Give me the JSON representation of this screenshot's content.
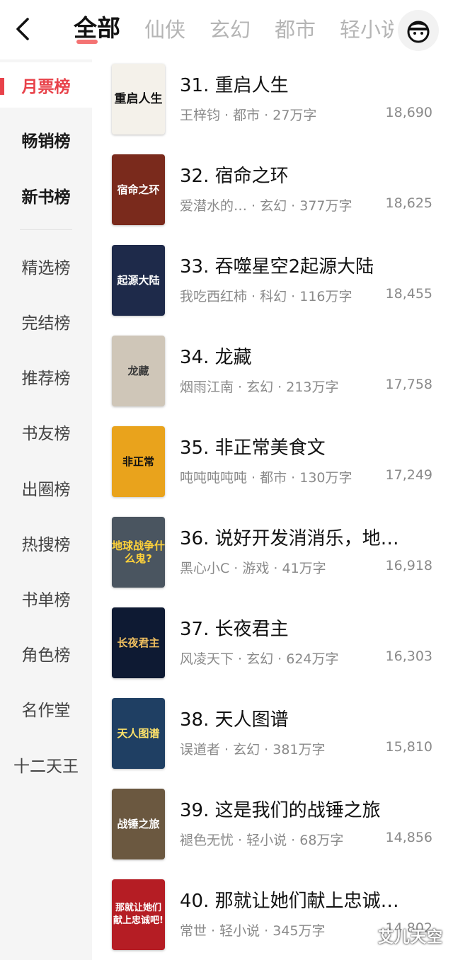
{
  "header": {
    "back_icon": "chevron-left-icon",
    "tabs": [
      {
        "label": "全部",
        "active": true
      },
      {
        "label": "仙侠"
      },
      {
        "label": "玄幻"
      },
      {
        "label": "都市"
      },
      {
        "label": "轻小说"
      }
    ],
    "avatar_icon": "user-avatar-icon"
  },
  "sidebar": {
    "items": [
      {
        "label": "月票榜"
      },
      {
        "label": "畅销榜"
      },
      {
        "label": "新书榜"
      },
      {
        "label": "精选榜"
      },
      {
        "label": "完结榜"
      },
      {
        "label": "推荐榜"
      },
      {
        "label": "书友榜"
      },
      {
        "label": "出圈榜"
      },
      {
        "label": "热搜榜"
      },
      {
        "label": "书单榜"
      },
      {
        "label": "角色榜"
      },
      {
        "label": "名作堂"
      },
      {
        "label": "十二天王"
      }
    ]
  },
  "books": [
    {
      "title": "31. 重启人生",
      "meta": "王梓钧 · 都市 · 27万字",
      "votes": "18,690",
      "cover_text": "重启人生",
      "cover_color": "#f4f1ea"
    },
    {
      "title": "32. 宿命之环",
      "meta": "爱潜水的… · 玄幻 · 377万字",
      "votes": "18,625",
      "cover_text": "宿命之环",
      "cover_color": "#7a2a1c"
    },
    {
      "title": "33. 吞噬星空2起源大陆",
      "meta": "我吃西红柿 · 科幻 · 116万字",
      "votes": "18,455",
      "cover_text": "起源大陆",
      "cover_color": "#1e2a4a"
    },
    {
      "title": "34. 龙藏",
      "meta": "烟雨江南 · 玄幻 · 213万字",
      "votes": "17,758",
      "cover_text": "龙藏",
      "cover_color": "#cfc6b8"
    },
    {
      "title": "35. 非正常美食文",
      "meta": "吨吨吨吨吨 · 都市 · 130万字",
      "votes": "17,249",
      "cover_text": "非正常",
      "cover_color": "#e9a31c"
    },
    {
      "title": "36. 说好开发消消乐，地…",
      "meta": "黑心小C · 游戏 · 41万字",
      "votes": "16,918",
      "cover_text": "地球战争什么鬼?",
      "cover_color": "#4a5560"
    },
    {
      "title": "37. 长夜君主",
      "meta": "风凌天下 · 玄幻 · 624万字",
      "votes": "16,303",
      "cover_text": "长夜君主",
      "cover_color": "#0e1a33"
    },
    {
      "title": "38. 天人图谱",
      "meta": "误道者 · 玄幻 · 381万字",
      "votes": "15,810",
      "cover_text": "天人图谱",
      "cover_color": "#1f3f63"
    },
    {
      "title": "39. 这是我们的战锤之旅",
      "meta": "褪色无忧 · 轻小说 · 68万字",
      "votes": "14,856",
      "cover_text": "战锤之旅",
      "cover_color": "#6b5840"
    },
    {
      "title": "40. 那就让她们献上忠诚…",
      "meta": "常世 · 轻小说 · 345万字",
      "votes": "14,802",
      "cover_text": "那就让她们献上忠诚吧!",
      "cover_color": "#b51d24"
    }
  ],
  "watermark": "艾儿天空"
}
